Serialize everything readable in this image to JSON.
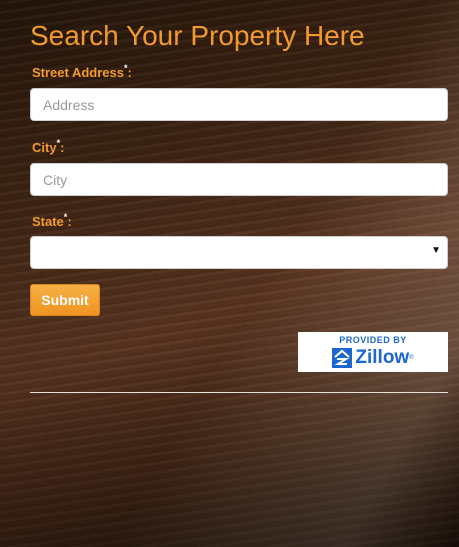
{
  "title": "Search Your Property Here",
  "form": {
    "street": {
      "label": "Street Address",
      "required_mark": "*",
      "suffix": ":",
      "placeholder": "Address",
      "value": ""
    },
    "city": {
      "label": "City",
      "required_mark": "*",
      "suffix": ":",
      "placeholder": "City",
      "value": ""
    },
    "state": {
      "label": "State",
      "required_mark": "*",
      "suffix": ":",
      "selected": "",
      "arrow": "▼"
    },
    "submit_label": "Submit"
  },
  "badge": {
    "provided_by": "PROVIDED BY",
    "brand": "Zillow",
    "reg_mark": "®",
    "icon": "zillow-logo-icon"
  },
  "colors": {
    "accent": "#f39a2e",
    "button": "#ee9420",
    "zillow_blue": "#1b66cf"
  }
}
